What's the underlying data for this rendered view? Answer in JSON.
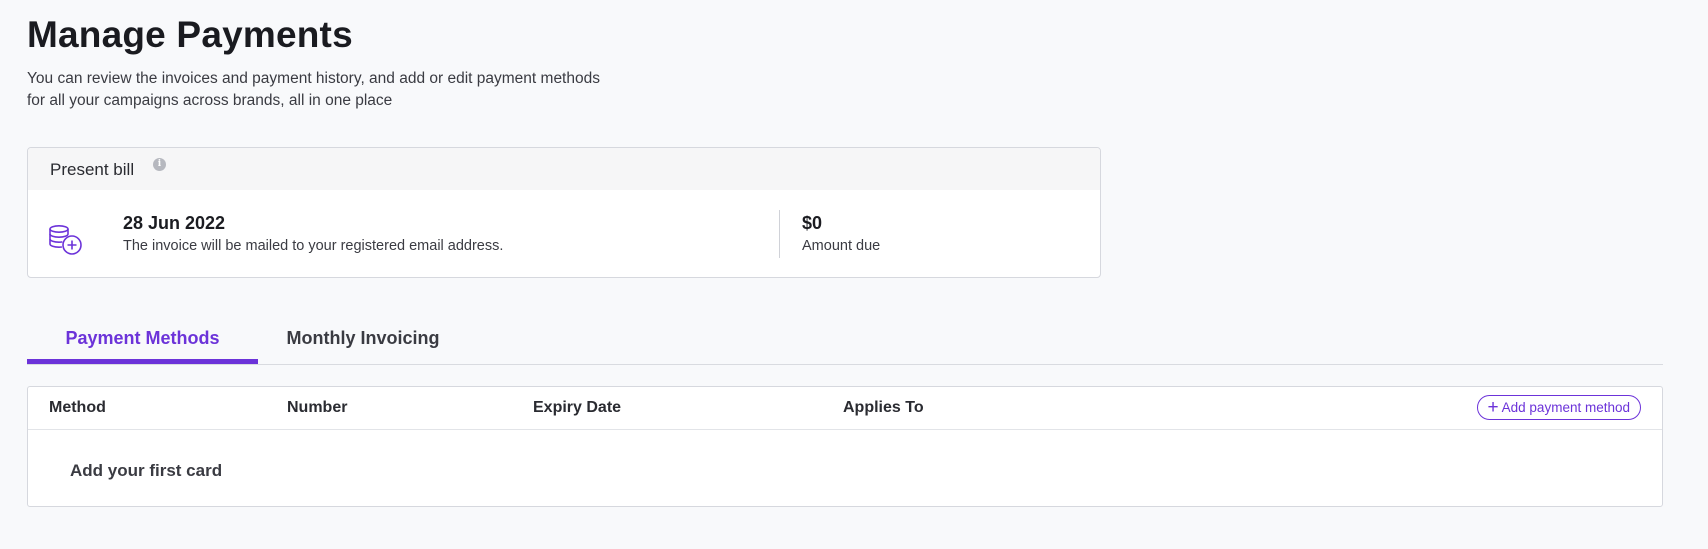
{
  "page": {
    "title": "Manage Payments",
    "subtitle_line1": "You can review the invoices and payment history, and add or edit payment methods",
    "subtitle_line2": "for all your campaigns across brands, all in one place"
  },
  "present_bill": {
    "header": "Present bill",
    "info_icon": "info-icon",
    "date": "28 Jun 2022",
    "note": "The invoice will be mailed to your registered email address.",
    "amount": "$0",
    "amount_label": "Amount due",
    "icon": "coins-add-icon"
  },
  "tabs": [
    {
      "label": "Payment Methods",
      "active": true
    },
    {
      "label": "Monthly Invoicing",
      "active": false
    }
  ],
  "table": {
    "columns": [
      "Method",
      "Number",
      "Expiry Date",
      "Applies To"
    ],
    "add_button_label": "Add payment method",
    "empty_text": "Add your first card"
  },
  "colors": {
    "accent": "#6c33d9",
    "background": "#f8f9fb",
    "border": "#d6d8de"
  }
}
